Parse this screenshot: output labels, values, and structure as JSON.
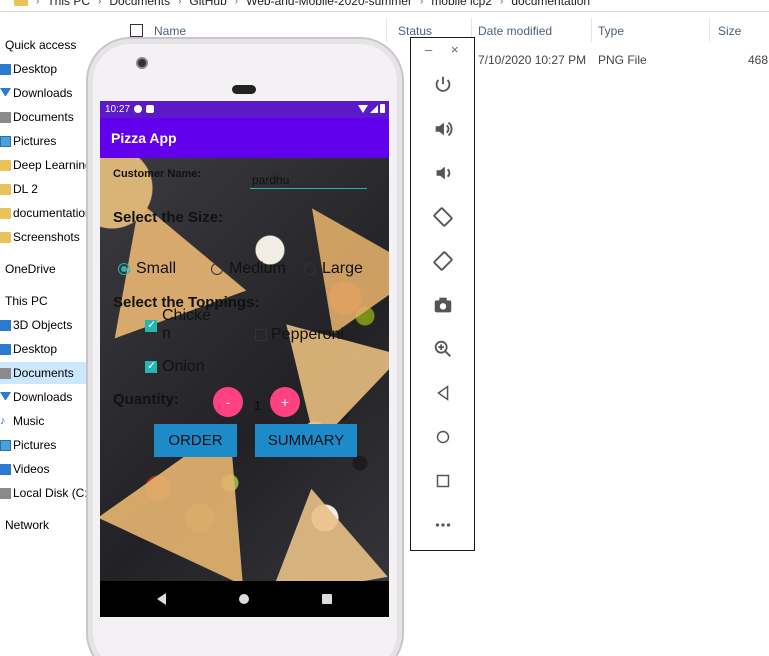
{
  "explorer": {
    "breadcrumb": [
      "This PC",
      "Documents",
      "GitHub",
      "Web-and-Mobile-2020-summer",
      "mobile icp2",
      "documentation"
    ],
    "columns": {
      "name": "Name",
      "status": "Status",
      "date": "Date modified",
      "type": "Type",
      "size": "Size"
    },
    "file": {
      "date": "7/10/2020 10:27 PM",
      "type": "PNG File",
      "size": "468"
    },
    "nav": {
      "quick_access": "Quick access",
      "desktop": "Desktop",
      "downloads": "Downloads",
      "documents": "Documents",
      "pictures": "Pictures",
      "deep_learning": "Deep Learning",
      "dl2": "DL 2",
      "documentation": "documentation",
      "screenshots": "Screenshots",
      "onedrive": "OneDrive",
      "this_pc": "This PC",
      "objects3d": "3D Objects",
      "desktop2": "Desktop",
      "documents2": "Documents",
      "downloads2": "Downloads",
      "music": "Music",
      "pictures2": "Pictures",
      "videos": "Videos",
      "local_disk": "Local Disk (C:)",
      "network": "Network"
    }
  },
  "phone": {
    "status": {
      "time": "10:27"
    },
    "app": {
      "title": "Pizza App",
      "customer_label": "Customer Name:",
      "customer_value": "pardhu",
      "size_heading": "Select the Size:",
      "sizes": [
        "Small",
        "Medium",
        "Large"
      ],
      "selected_size": "Small",
      "toppings_heading": "Select the Toppings:",
      "toppings": {
        "chicken": {
          "label": "Chicke\nn",
          "checked": true
        },
        "pepperoni": {
          "label": "Pepperoni",
          "checked": false
        },
        "onion": {
          "label": "Onion",
          "checked": true
        }
      },
      "quantity_label": "Quantity:",
      "minus": "-",
      "plus": "+",
      "quantity": "1",
      "order_button": "ORDER",
      "summary_button": "SUMMARY"
    }
  },
  "toolbar": {
    "minimize": "–",
    "close": "×",
    "buttons": [
      "power-icon",
      "volume-up-icon",
      "volume-down-icon",
      "rotate-left-icon",
      "rotate-right-icon",
      "camera-icon",
      "zoom-icon",
      "back-icon",
      "home-icon",
      "overview-icon",
      "more-icon"
    ]
  },
  "colors": {
    "status_bar": "#5b1ac8",
    "app_bar": "#6200ee",
    "accent": "#26b5b0",
    "fab_pink": "#ff4081",
    "button_blue": "#1d8ac9"
  }
}
